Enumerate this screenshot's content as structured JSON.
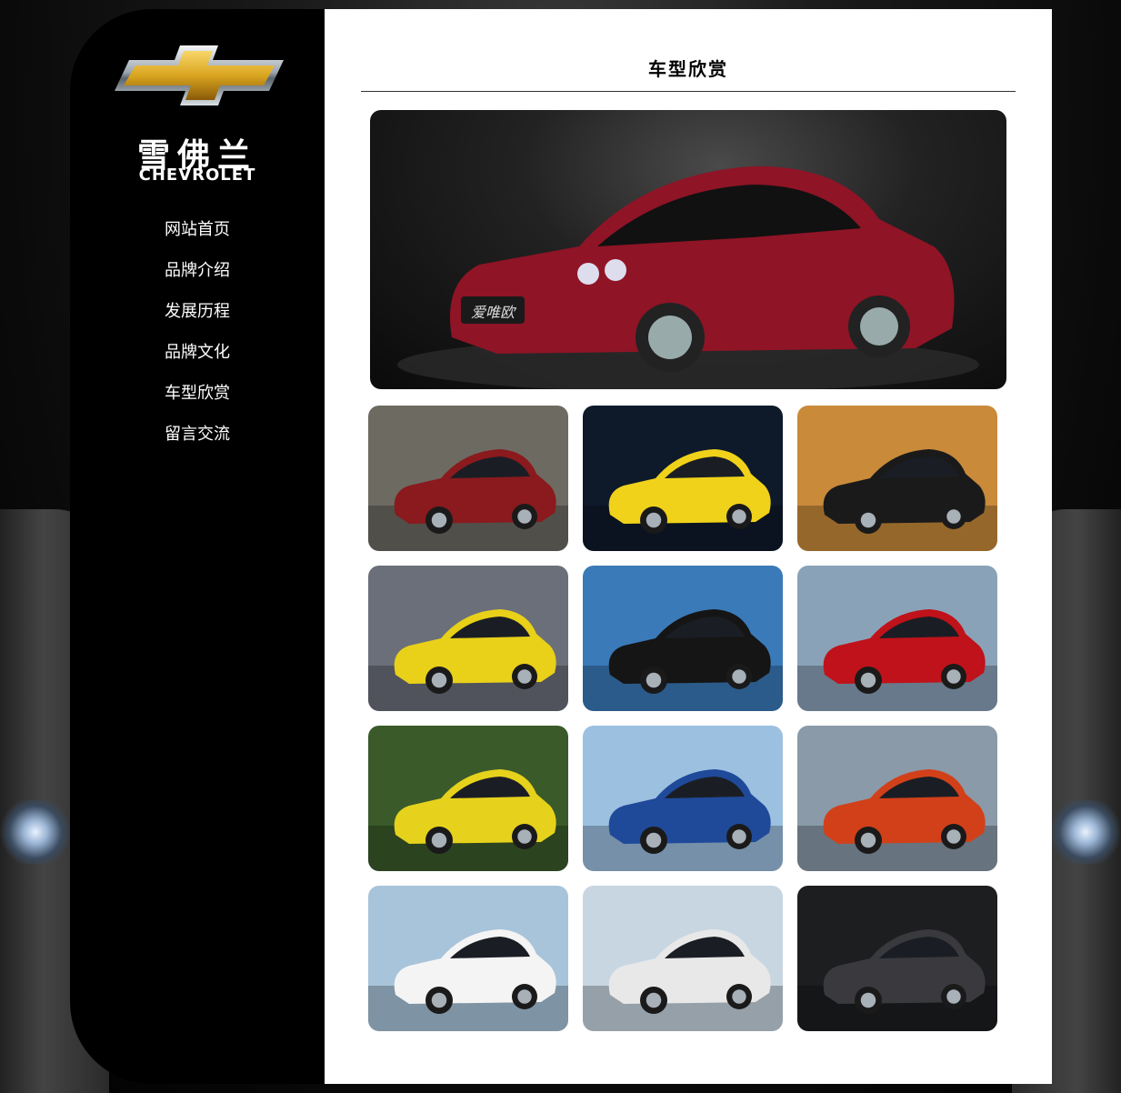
{
  "brand": {
    "name_cn": "雪佛兰",
    "name_en": "CHEVROLET",
    "logo_icon": "chevrolet-bowtie-icon",
    "logo_color": "#d9a520"
  },
  "nav": {
    "items": [
      {
        "label": "网站首页"
      },
      {
        "label": "品牌介绍"
      },
      {
        "label": "发展历程"
      },
      {
        "label": "品牌文化"
      },
      {
        "label": "车型欣赏"
      },
      {
        "label": "留言交流"
      }
    ]
  },
  "page": {
    "title": "车型欣赏"
  },
  "gallery": {
    "hero": {
      "plate": "爱唯欧",
      "body_color": "#8e1426",
      "scene": "#1a1a1a"
    },
    "thumbs": [
      {
        "plate": "",
        "body_color": "#8a1a1e",
        "scene": "#6d6a62"
      },
      {
        "plate": "",
        "body_color": "#f0d21a",
        "scene": "#0e1a2a"
      },
      {
        "plate": "",
        "body_color": "#1a1a1a",
        "scene": "#c98a3a"
      },
      {
        "plate": "",
        "body_color": "#e9d019",
        "scene": "#6b6f7a"
      },
      {
        "plate": "",
        "body_color": "#151515",
        "scene": "#3a7ab8"
      },
      {
        "plate": "",
        "body_color": "#c0121a",
        "scene": "#8aa2b8"
      },
      {
        "plate": "",
        "body_color": "#e6d21c",
        "scene": "#3a5a2a"
      },
      {
        "plate": "",
        "body_color": "#1f4a9a",
        "scene": "#9cc0e0"
      },
      {
        "plate": "",
        "body_color": "#d2401a",
        "scene": "#8a9aa8"
      },
      {
        "plate": "",
        "body_color": "#f4f4f4",
        "scene": "#a8c4da"
      },
      {
        "plate": "",
        "body_color": "#e8e8e8",
        "scene": "#c8d6e2"
      },
      {
        "plate": "",
        "body_color": "#3a3a3e",
        "scene": "#1c1e20"
      }
    ]
  }
}
